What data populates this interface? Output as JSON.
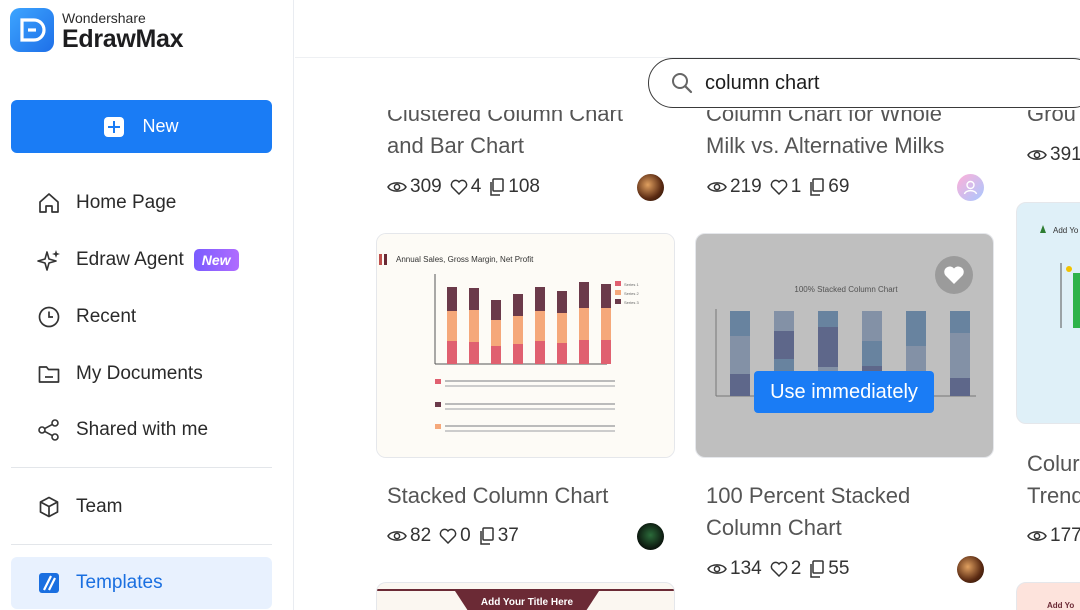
{
  "logo": {
    "brand": "Wondershare",
    "product": "EdrawMax"
  },
  "sidebar": {
    "new_label": "New",
    "items": [
      {
        "label": "Home Page",
        "icon": "home-icon"
      },
      {
        "label": "Edraw Agent",
        "icon": "sparkle-icon",
        "badge": "New"
      },
      {
        "label": "Recent",
        "icon": "clock-icon"
      },
      {
        "label": "My Documents",
        "icon": "folder-icon"
      },
      {
        "label": "Shared with me",
        "icon": "share-icon"
      },
      {
        "label": "Team",
        "icon": "cube-icon"
      },
      {
        "label": "Templates",
        "icon": "templates-icon",
        "active": true
      }
    ]
  },
  "search": {
    "value": "column chart",
    "icon": "search-icon"
  },
  "cards_top": [
    {
      "title_line1": "Clustered Column Chart",
      "title_line2": "and Bar Chart",
      "views": "309",
      "likes": "4",
      "copies": "108"
    },
    {
      "title_line1": "Column Chart for Whole",
      "title_line2": "Milk vs. Alternative Milks",
      "views": "219",
      "likes": "1",
      "copies": "69"
    },
    {
      "title_line1": "Grou",
      "views": "391"
    }
  ],
  "cards_middle": [
    {
      "title": "Stacked Column Chart",
      "views": "82",
      "likes": "0",
      "copies": "37",
      "chart_title": "Annual Sales, Gross Margin, Net Profit",
      "legend": [
        "Series 1",
        "Series 2",
        "Series 3"
      ]
    },
    {
      "title_line1": "100 Percent Stacked",
      "title_line2": "Column Chart",
      "views": "134",
      "likes": "2",
      "copies": "55",
      "chart_title": "100% Stacked Column Chart",
      "action": "Use immediately"
    },
    {
      "title_line1": "Colur",
      "title_line2": "Trend",
      "views": "177",
      "thumb_text": "Add Yo"
    }
  ],
  "cards_bottom": [
    {
      "banner": "Add Your Title Here"
    },
    {
      "banner": "Add Yo"
    }
  ],
  "colors": {
    "accent": "#1a7cf5",
    "active_bg": "#e8f1fe"
  }
}
